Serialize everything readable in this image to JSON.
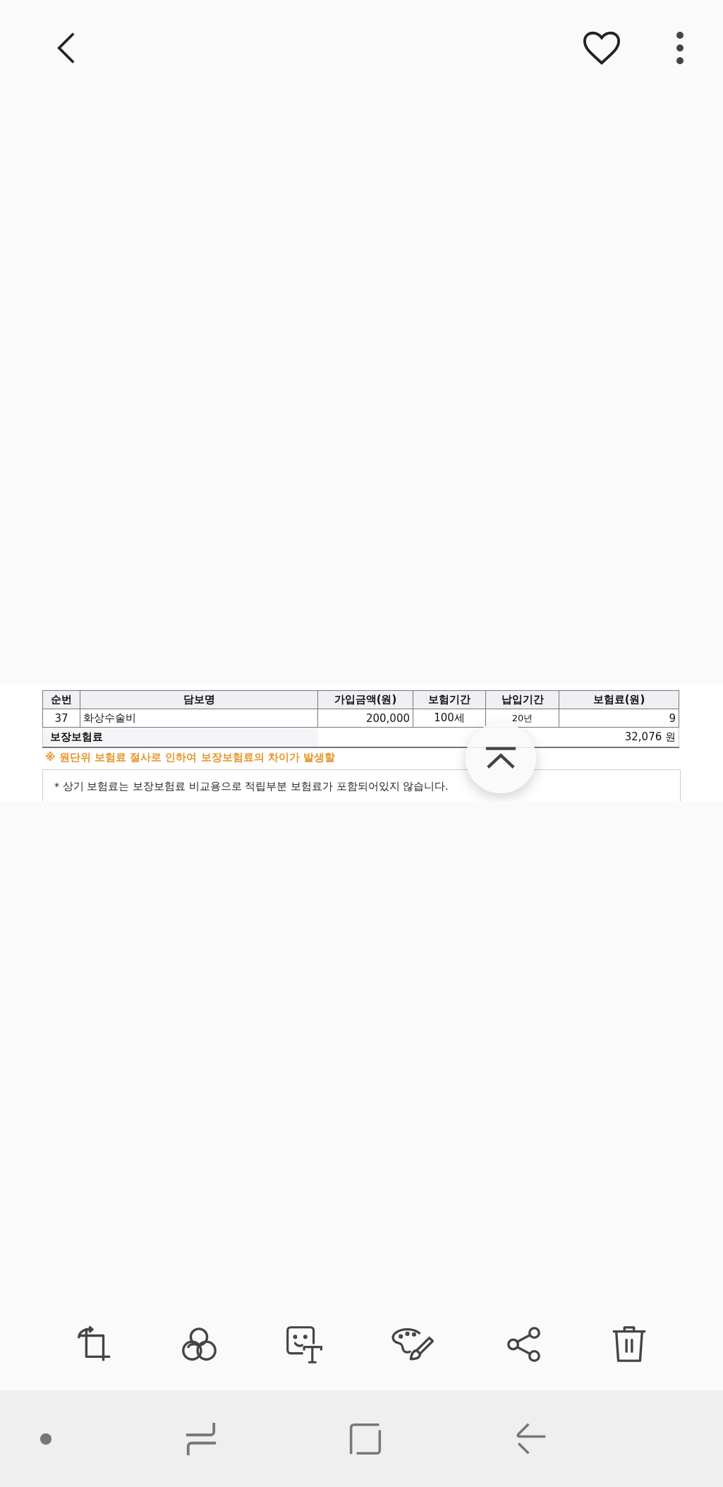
{
  "document": {
    "table": {
      "columns": [
        "순번",
        "담보명",
        "가입금액(원)",
        "보험기간",
        "납입기간",
        "보험료(원)"
      ],
      "rows": [
        {
          "cells": [
            "37",
            "화상수술비",
            "200,000",
            "100세",
            "20년",
            "9"
          ]
        }
      ],
      "total": {
        "label": "보장보험료",
        "value": "32,076 원"
      }
    },
    "notice": "※ 원단위 보험료 절사로 인하여 보장보험료의 차이가 발생할",
    "remarks": [
      "* 상기 보험료는 보장보험료 비교용으로 적립부분 보험료가 포함되어있지 않습니다."
    ]
  }
}
